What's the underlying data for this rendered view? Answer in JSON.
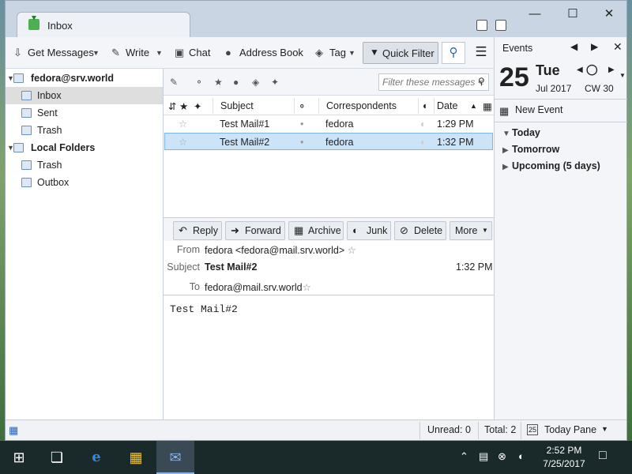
{
  "window": {
    "tab_title": "Inbox"
  },
  "toolbar": {
    "get_messages": "Get Messages",
    "write": "Write",
    "chat": "Chat",
    "address_book": "Address Book",
    "tag": "Tag",
    "quick_filter": "Quick Filter"
  },
  "folders": {
    "account": "fedora@srv.world",
    "inbox": "Inbox",
    "sent": "Sent",
    "trash": "Trash",
    "local_folders": "Local Folders",
    "local_trash": "Trash",
    "outbox": "Outbox"
  },
  "filter": {
    "placeholder": "Filter these messages <"
  },
  "columns": {
    "subject": "Subject",
    "correspondents": "Correspondents",
    "date": "Date"
  },
  "messages": [
    {
      "subject": "Test Mail#1",
      "correspondent": "fedora",
      "date": "1:29 PM"
    },
    {
      "subject": "Test Mail#2",
      "correspondent": "fedora",
      "date": "1:32 PM"
    }
  ],
  "message_toolbar": {
    "reply": "Reply",
    "forward": "Forward",
    "archive": "Archive",
    "junk": "Junk",
    "delete": "Delete",
    "more": "More"
  },
  "message_header": {
    "from_label": "From",
    "from_value": "fedora <fedora@mail.srv.world>",
    "subject_label": "Subject",
    "subject_value": "Test Mail#2",
    "time": "1:32 PM",
    "to_label": "To",
    "to_value": "fedora@mail.srv.world"
  },
  "message_body": "Test Mail#2",
  "today_pane": {
    "title": "Events",
    "day": "25",
    "weekday": "Tue",
    "month_year": "Jul 2017",
    "week": "CW 30",
    "new_event": "New Event",
    "groups": [
      "Today",
      "Tomorrow",
      "Upcoming (5 days)"
    ]
  },
  "statusbar": {
    "unread": "Unread: 0",
    "total": "Total: 2",
    "today_pane": "Today Pane",
    "today_icon_day": "25"
  },
  "taskbar": {
    "time": "2:52 PM",
    "date": "7/25/2017"
  }
}
